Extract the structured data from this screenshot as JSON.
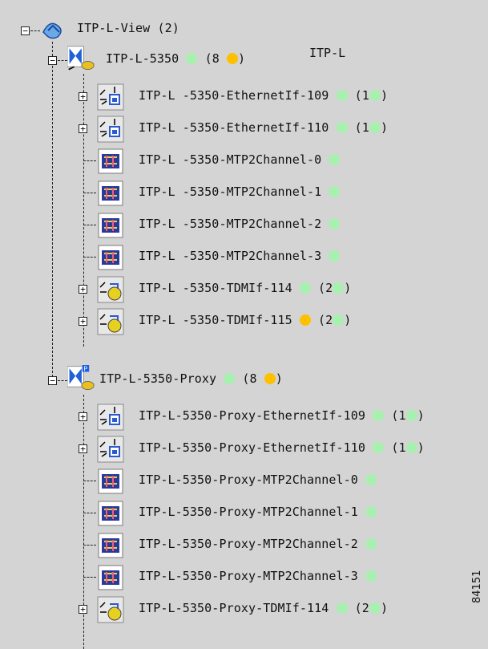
{
  "root": {
    "label": "ITP-L-View (2)"
  },
  "overlay_label": "ITP-L",
  "figure_id": "84151",
  "nodes": [
    {
      "label": "ITP-L-5350",
      "count": "(8",
      "count_close": ")",
      "status": "green",
      "child_status": "orange",
      "children": [
        {
          "label": "ITP-L -5350-EthernetIf-109",
          "status": "green",
          "count": "(1",
          "child_status": "green",
          "close": ")",
          "kind": "ethernet",
          "expandable": true
        },
        {
          "label": "ITP-L -5350-EthernetIf-110",
          "status": "green",
          "count": "(1",
          "child_status": "green",
          "close": ")",
          "kind": "ethernet",
          "expandable": true
        },
        {
          "label": "ITP-L -5350-MTP2Channel-0",
          "status": "green",
          "kind": "mtp2",
          "expandable": false
        },
        {
          "label": "ITP-L -5350-MTP2Channel-1",
          "status": "green",
          "kind": "mtp2",
          "expandable": false
        },
        {
          "label": "ITP-L -5350-MTP2Channel-2",
          "status": "green",
          "kind": "mtp2",
          "expandable": false
        },
        {
          "label": "ITP-L -5350-MTP2Channel-3",
          "status": "green",
          "kind": "mtp2",
          "expandable": false
        },
        {
          "label": "ITP-L -5350-TDMIf-114",
          "status": "green",
          "count": "(2",
          "child_status": "green",
          "close": ")",
          "kind": "tdm",
          "expandable": true
        },
        {
          "label": "ITP-L -5350-TDMIf-115",
          "status": "orange",
          "count": "(2",
          "child_status": "green",
          "close": ")",
          "kind": "tdm",
          "expandable": true
        }
      ]
    },
    {
      "label": "ITP-L-5350-Proxy",
      "count": "(8",
      "count_close": ")",
      "status": "green",
      "child_status": "orange",
      "children": [
        {
          "label": "ITP-L-5350-Proxy-EthernetIf-109",
          "status": "green",
          "count": "(1",
          "child_status": "green",
          "close": ")",
          "kind": "ethernet",
          "expandable": true
        },
        {
          "label": "ITP-L-5350-Proxy-EthernetIf-110",
          "status": "green",
          "count": "(1",
          "child_status": "green",
          "close": ")",
          "kind": "ethernet",
          "expandable": true
        },
        {
          "label": "ITP-L-5350-Proxy-MTP2Channel-0",
          "status": "green",
          "kind": "mtp2",
          "expandable": false
        },
        {
          "label": "ITP-L-5350-Proxy-MTP2Channel-1",
          "status": "green",
          "kind": "mtp2",
          "expandable": false
        },
        {
          "label": "ITP-L-5350-Proxy-MTP2Channel-2",
          "status": "green",
          "kind": "mtp2",
          "expandable": false
        },
        {
          "label": "ITP-L-5350-Proxy-MTP2Channel-3",
          "status": "green",
          "kind": "mtp2",
          "expandable": false
        },
        {
          "label": "ITP-L-5350-Proxy-TDMIf-114",
          "status": "green",
          "count": "(2",
          "child_status": "green",
          "close": ")",
          "kind": "tdm",
          "expandable": true
        }
      ]
    }
  ],
  "colors": {
    "green": "#a8f0b0",
    "orange": "#ffc000",
    "background": "#d4d4d4"
  }
}
